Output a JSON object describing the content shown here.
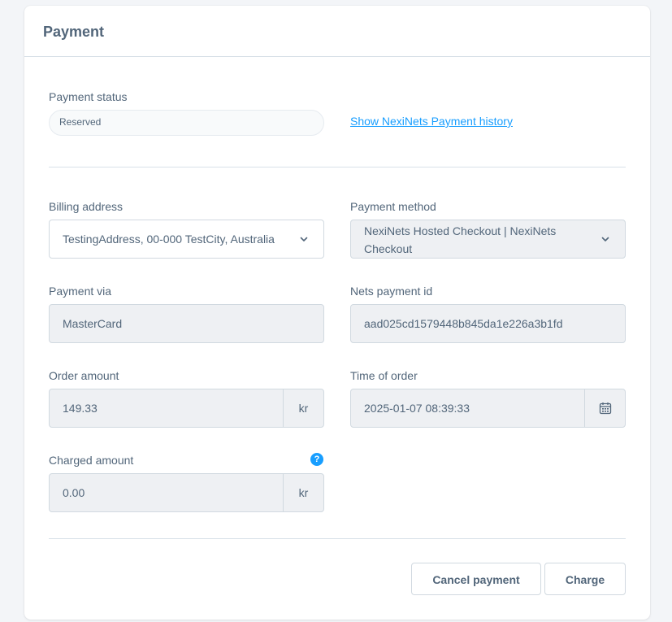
{
  "card": {
    "title": "Payment"
  },
  "payment_status": {
    "label": "Payment status",
    "value": "Reserved"
  },
  "history_link": "Show NexiNets Payment history",
  "billing_address": {
    "label": "Billing address",
    "value": "TestingAddress, 00-000 TestCity, Australia"
  },
  "payment_method": {
    "label": "Payment method",
    "value": "NexiNets Hosted Checkout | NexiNets Checkout"
  },
  "payment_via": {
    "label": "Payment via",
    "value": "MasterCard"
  },
  "nets_payment_id": {
    "label": "Nets payment id",
    "value": "aad025cd1579448b845da1e226a3b1fd"
  },
  "order_amount": {
    "label": "Order amount",
    "value": "149.33",
    "currency": "kr"
  },
  "time_of_order": {
    "label": "Time of order",
    "value": "2025-01-07 08:39:33"
  },
  "charged_amount": {
    "label": "Charged amount",
    "value": "0.00",
    "currency": "kr",
    "help": "?"
  },
  "actions": {
    "cancel": "Cancel payment",
    "charge": "Charge"
  },
  "colors": {
    "accent": "#189eff",
    "text": "#52667a",
    "border": "#d1d9e0",
    "field_bg": "#eef0f3"
  },
  "icons": {
    "dropdown": "chevron-down-icon",
    "calendar": "calendar-icon",
    "help": "question-icon"
  }
}
